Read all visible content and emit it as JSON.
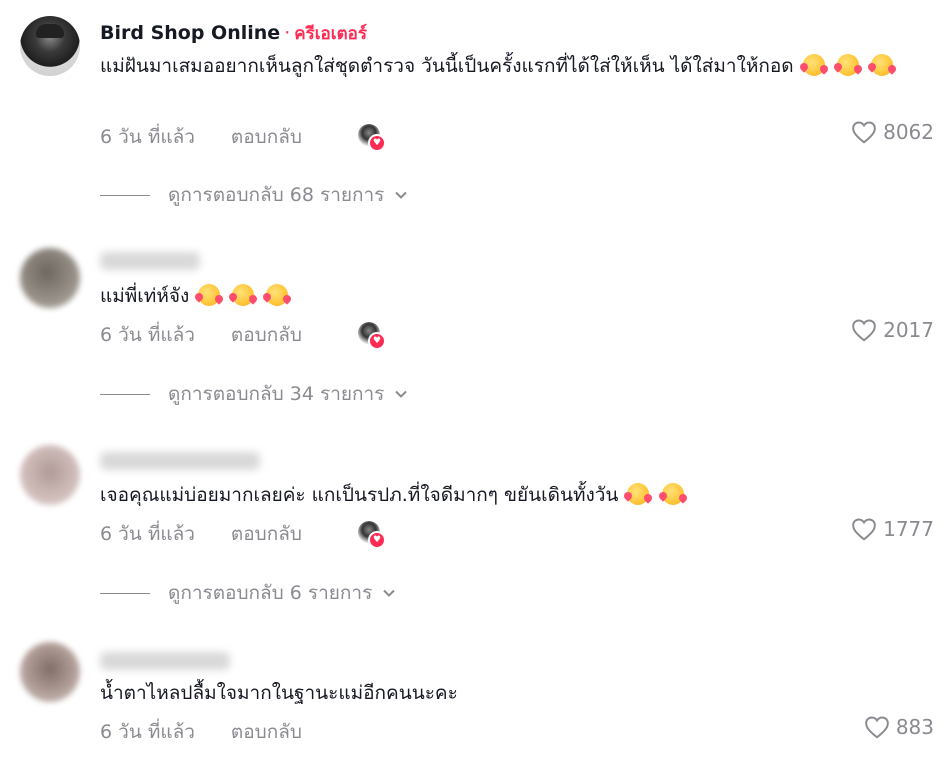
{
  "comments": [
    {
      "author": "Bird Shop Online",
      "creator_tag": "ครีเอเตอร์",
      "text": "แม่ฝันมาเสมออยากเห็นลูกใส่ชุดตำรวจ วันนี้เป็นครั้งแรกที่ได้ใส่ให้เห็น ได้ใส่มาให้กอด",
      "time": "6 วัน ที่แล้ว",
      "reply_label": "ตอบกลับ",
      "likes": "8062",
      "replies_label": "ดูการตอบกลับ 68 รายการ"
    },
    {
      "author": "",
      "text": "แม่พี่เท่ห์จัง",
      "time": "6 วัน ที่แล้ว",
      "reply_label": "ตอบกลับ",
      "likes": "2017",
      "replies_label": "ดูการตอบกลับ 34 รายการ"
    },
    {
      "author": "",
      "text": "เจอคุณแม่บ่อยมากเลยค่ะ แกเป็นรปภ.ที่ใจดีมากๆ ขยันเดินทั้งวัน",
      "time": "6 วัน ที่แล้ว",
      "reply_label": "ตอบกลับ",
      "likes": "1777",
      "replies_label": "ดูการตอบกลับ 6 รายการ"
    },
    {
      "author": "",
      "text": "น้ำตาไหลปลื้มใจมากในฐานะแม่อีกคนนะคะ",
      "time": "6 วัน ที่แล้ว",
      "reply_label": "ตอบกลับ",
      "likes": "883"
    }
  ],
  "colors": {
    "accent": "#fe2c55",
    "muted": "#8a8b91",
    "text": "#161823"
  },
  "icons": {
    "like": "heart-outline-icon",
    "expand": "chevron-down-icon",
    "emoji": "smiling-face-with-hearts-emoji"
  }
}
